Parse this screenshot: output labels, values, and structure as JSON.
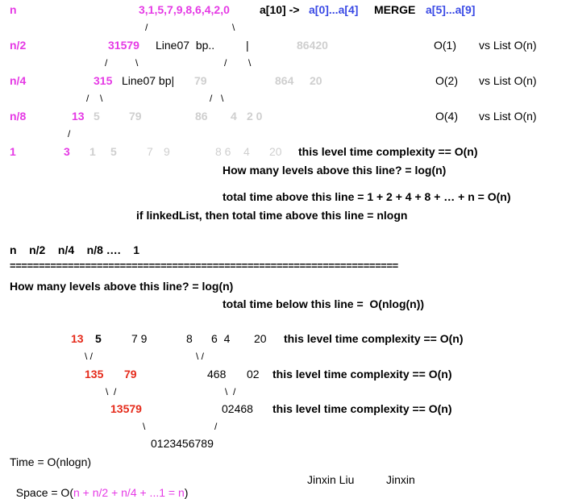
{
  "top": {
    "n_label": "n",
    "array": "3,1,5,7,9,8,6,4,2,0",
    "header_a10": "a[10] ->",
    "header_a0a4": "a[0]...a[4]",
    "header_merge": "MERGE",
    "header_a5a9": "a[5]...a[9]",
    "slash_l0": "/",
    "slash_r0": "\\",
    "n2_label": "n/2",
    "n2_left": "31579",
    "n2_note": "Line07  bp..",
    "n2_bar": "|",
    "n2_right": "86420",
    "n2_cost": "O(1)",
    "n2_vs": "vs List O(n)",
    "slash_l1a": "/",
    "slash_l1b": "\\",
    "slash_r1a": "/",
    "slash_r1b": "\\",
    "n4_label": "n/4",
    "n4_left": "315",
    "n4_note": "Line07 bp|",
    "n4_g1": "79",
    "n4_g2": "864",
    "n4_g3": "20",
    "n4_cost": "O(2)",
    "n4_vs": "vs List O(n)",
    "slash_l2a": "/",
    "slash_l2b": "\\",
    "slash_r2a": "/",
    "slash_r2b": "\\",
    "n8_label": "n/8",
    "n8_left": "13",
    "n8_g1": "5",
    "n8_g2": "79",
    "n8_g3": "86",
    "n8_g4": "4",
    "n8_g5": "2 0",
    "n8_cost": "O(4)",
    "n8_vs": "vs List O(n)",
    "slash_l3": "/",
    "one_label": "1",
    "one_3": "3",
    "one_g1": "1",
    "one_g2": "5",
    "one_g3": "7",
    "one_g4": "9",
    "one_g5": "8 6",
    "one_g6": "4",
    "one_g7": "20",
    "one_cost": "this level time complexity == O(n)",
    "levels_q": "How many levels above this line? = log(n)",
    "total_above": "total time above this line = 1 + 2 + 4 + 8 + … + n = O(n)",
    "linked_list": "if linkedList, then total time above this line = nlogn"
  },
  "middle": {
    "series": "n    n/2    n/4    n/8 ….    1",
    "divider": "===================================================================",
    "levels_q": "How many levels above this line? = log(n)",
    "total_below": "total time below this line =  O(nlog(n))"
  },
  "bottom": {
    "r1_13": "13",
    "r1_5": "5",
    "r1_79": "7 9",
    "r1_8": "8",
    "r1_64": "6  4",
    "r1_20": "20",
    "r1_cost": "this level time complexity == O(n)",
    "s1_l": "\\ /",
    "s1_r": "\\ /",
    "r2_135": "135",
    "r2_79": "79",
    "r2_468": "468",
    "r2_02": "02",
    "r2_cost": "this level time complexity == O(n)",
    "s2_l": "\\  /",
    "s2_r": "\\  /",
    "r3_13579": "13579",
    "r3_02468": "02468",
    "r3_cost": "this level time complexity == O(n)",
    "s3_l": "\\",
    "s3_r": "/",
    "result": "0123456789",
    "time": "Time = O(nlogn)",
    "space_pre": "Space = O(",
    "space_mid": "n + n/2 + n/4 + ...1 = n",
    "space_post": ")",
    "author1": "Jinxin Liu",
    "author2": "Jinxin"
  }
}
